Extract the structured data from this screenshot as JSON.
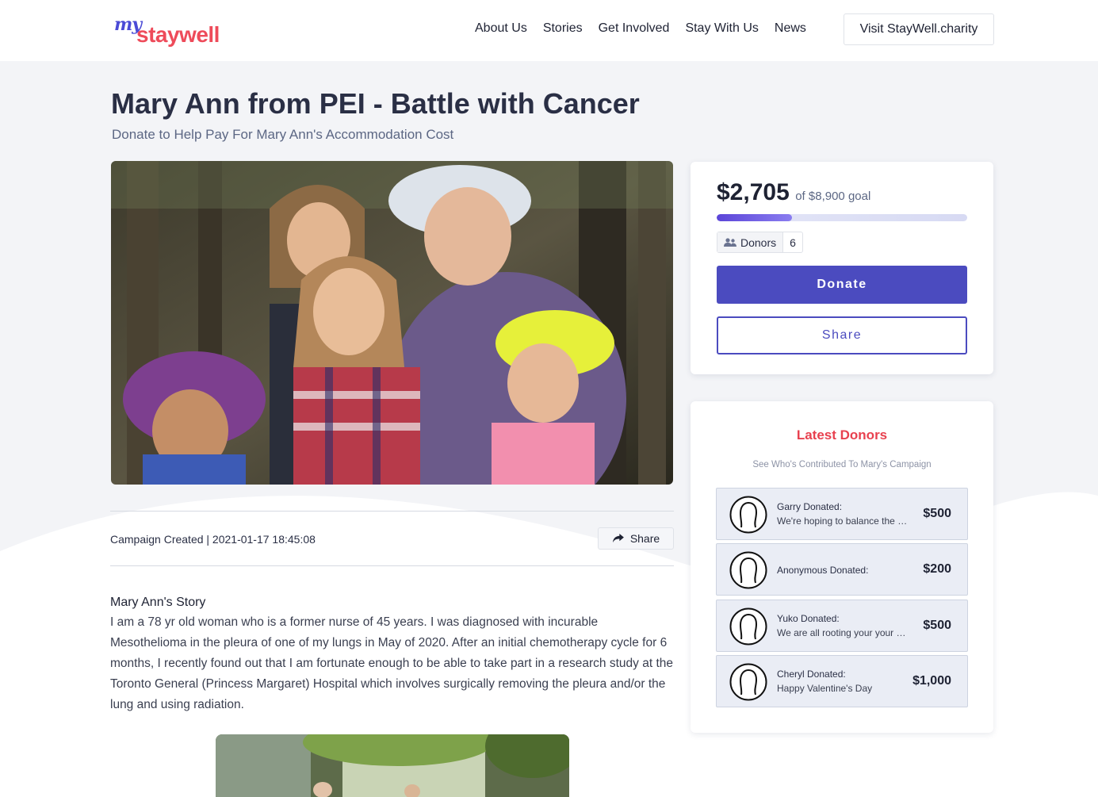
{
  "brand": {
    "logo_my": "my",
    "logo_main": "staywell"
  },
  "nav": {
    "items": [
      "About Us",
      "Stories",
      "Get Involved",
      "Stay With Us",
      "News"
    ],
    "visit_label": "Visit StayWell.charity"
  },
  "campaign": {
    "title": "Mary Ann from PEI - Battle with Cancer",
    "subtitle": "Donate to Help Pay For Mary Ann's Accommodation Cost",
    "created_label": "Campaign Created | 2021-01-17 18:45:08",
    "share_label": "Share",
    "story_heading": "Mary Ann's Story",
    "story_text": "I am a 78 yr old woman who is a former nurse of 45 years.  I was diagnosed with incurable Mesothelioma in the pleura of one of my lungs in May of 2020.  After an initial chemotherapy cycle for 6 months, I recently found out that I am fortunate enough to be able to take part in a research study at the Toronto General (Princess Margaret) Hospital which involves surgically removing the pleura and/or the lung and using radiation."
  },
  "fundraising": {
    "raised": "$2,705",
    "goal_text": "of $8,900 goal",
    "progress_fraction": 0.3,
    "donors_label": "Donors",
    "donors_count": "6",
    "donate_label": "Donate",
    "share_label": "Share"
  },
  "latest_donors": {
    "title": "Latest Donors",
    "subtitle": "See Who's Contributed To Mary's Campaign",
    "items": [
      {
        "name": "Garry Donated:",
        "message": "We're hoping to balance the scales for you",
        "amount": "$500"
      },
      {
        "name": "Anonymous Donated:",
        "message": "",
        "amount": "$200"
      },
      {
        "name": "Yuko Donated:",
        "message": "We are all rooting your your recovery",
        "amount": "$500"
      },
      {
        "name": "Cheryl Donated:",
        "message": "Happy Valentine's Day",
        "amount": "$1,000"
      }
    ]
  },
  "colors": {
    "accent": "#4b4bbf",
    "brand_red": "#ee4b5a",
    "title_red": "#e8414f"
  }
}
